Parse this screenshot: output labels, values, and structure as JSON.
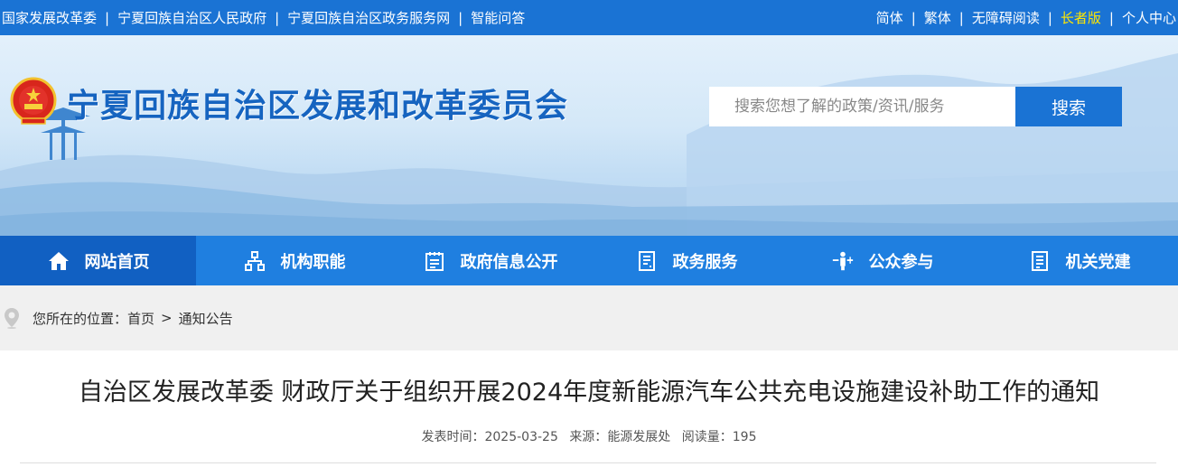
{
  "topbar": {
    "left_links": [
      "国家发展改革委",
      "宁夏回族自治区人民政府",
      "宁夏回族自治区政务服务网",
      "智能问答"
    ],
    "right_links": [
      {
        "label": "简体"
      },
      {
        "label": "繁体"
      },
      {
        "label": "无障碍阅读"
      },
      {
        "label": "长者版",
        "highlight": true
      },
      {
        "label": "个人中心"
      }
    ],
    "separator": "|",
    "highlight_color": "#ffe600"
  },
  "header": {
    "site_title": "宁夏回族自治区发展和改革委员会",
    "emblem_icon": "national-emblem-icon",
    "search": {
      "placeholder": "搜索您想了解的政策/资讯/服务",
      "button_label": "搜索"
    }
  },
  "nav": {
    "items": [
      {
        "label": "网站首页",
        "icon": "home-icon",
        "active": true
      },
      {
        "label": "机构职能",
        "icon": "org-chart-icon"
      },
      {
        "label": "政府信息公开",
        "icon": "calendar-list-icon"
      },
      {
        "label": "政务服务",
        "icon": "document-list-icon"
      },
      {
        "label": "公众参与",
        "icon": "people-icon"
      },
      {
        "label": "机关党建",
        "icon": "document-icon"
      }
    ]
  },
  "breadcrumb": {
    "prefix": "您所在的位置：",
    "items": [
      "首页",
      "通知公告"
    ],
    "separator": ">"
  },
  "article": {
    "title": "自治区发展改革委 财政厅关于组织开展2024年度新能源汽车公共充电设施建设补助工作的通知",
    "publish_label": "发表时间：",
    "publish_date": "2025-03-25",
    "source_label": "来源：",
    "source": "能源发展处",
    "views_label": "阅读量：",
    "views": "195"
  },
  "colors": {
    "primary": "#1a73d4",
    "nav_bg": "#1f7fe0",
    "nav_active": "#1160c2",
    "title_blue": "#1664c0"
  }
}
